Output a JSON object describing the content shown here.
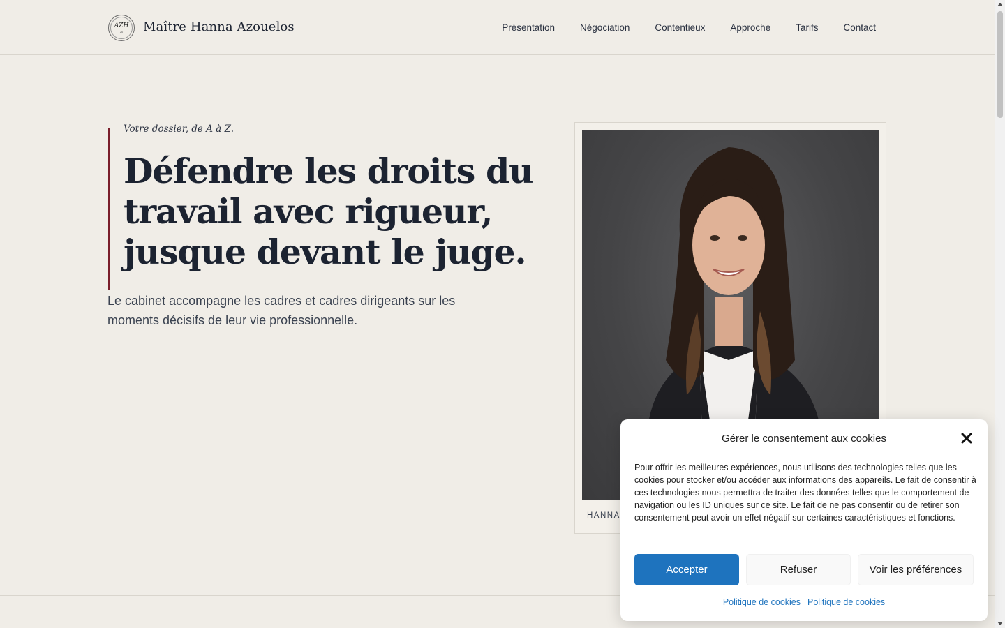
{
  "header": {
    "logo": {
      "monogram": "AZH",
      "sub": "26"
    },
    "brand": "Maître Hanna Azouelos",
    "nav": [
      "Présentation",
      "Négociation",
      "Contentieux",
      "Approche",
      "Tarifs",
      "Contact"
    ]
  },
  "hero": {
    "eyebrow": "Votre dossier, de A à Z.",
    "headline": "Défendre les droits du travail avec rigueur, jusque devant le juge.",
    "lead": "Le cabinet accompagne les cadres et cadres dirigeants sur les moments décisifs de leur vie professionnelle.",
    "photo_caption": "HANNA"
  },
  "cookie": {
    "title": "Gérer le consentement aux cookies",
    "text": "Pour offrir les meilleures expériences, nous utilisons des technologies telles que les cookies pour stocker et/ou accéder aux informations des appareils. Le fait de consentir à ces technologies nous permettra de traiter des données telles que le comportement de navigation ou les ID uniques sur ce site. Le fait de ne pas consentir ou de retirer son consentement peut avoir un effet négatif sur certaines caractéristiques et fonctions.",
    "accept": "Accepter",
    "refuse": "Refuser",
    "preferences": "Voir les préférences",
    "links": [
      "Politique de cookies",
      "Politique de cookies"
    ]
  },
  "colors": {
    "background": "#f0ede7",
    "accent_bar": "#7a1e2b",
    "primary_button": "#1e73be",
    "text_dark": "#1c2331"
  }
}
